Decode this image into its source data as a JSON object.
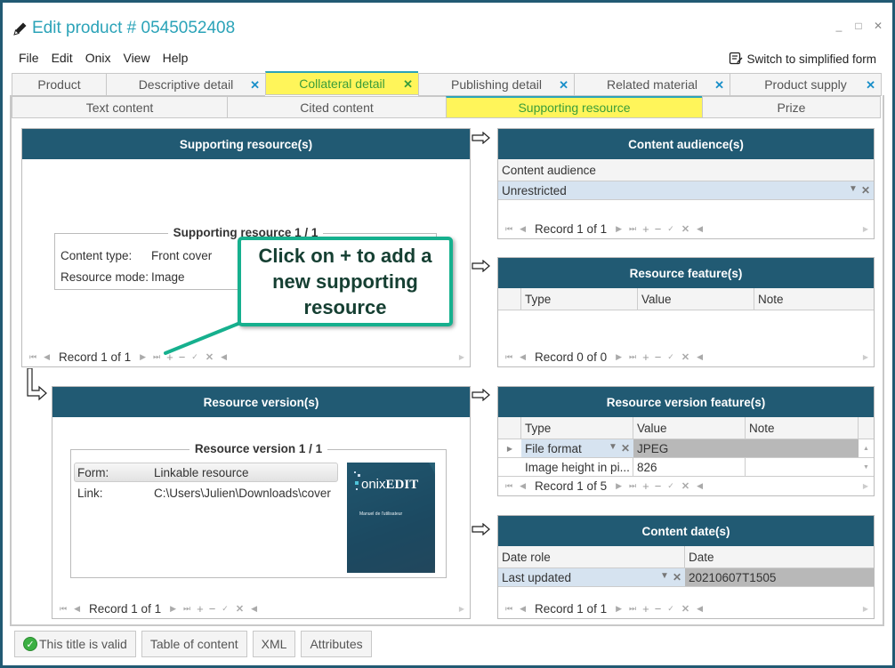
{
  "window": {
    "title": "Edit product # 0545052408",
    "controls": {
      "minimize": "_",
      "maximize": "□",
      "close": "✕"
    }
  },
  "menu": {
    "items": [
      "File",
      "Edit",
      "Onix",
      "View",
      "Help"
    ]
  },
  "switch_link": "Switch to simplified form",
  "main_tabs": [
    {
      "label": "Product",
      "closable": false,
      "active": false
    },
    {
      "label": "Descriptive detail",
      "closable": true,
      "active": false
    },
    {
      "label": "Collateral detail",
      "closable": true,
      "active": true
    },
    {
      "label": "Publishing detail",
      "closable": true,
      "active": false
    },
    {
      "label": "Related material",
      "closable": true,
      "active": false
    },
    {
      "label": "Product supply",
      "closable": true,
      "active": false
    }
  ],
  "sub_tabs": [
    {
      "label": "Text content",
      "active": false
    },
    {
      "label": "Cited content",
      "active": false
    },
    {
      "label": "Supporting resource",
      "active": true
    },
    {
      "label": "Prize",
      "active": false
    }
  ],
  "nav_icons": {
    "first": "⏮",
    "prev": "◀",
    "next": "▶",
    "last": "⏭",
    "add": "+",
    "remove": "−",
    "confirm": "✓",
    "cancel": "✕"
  },
  "supporting_resources": {
    "header": "Supporting resource(s)",
    "legend": "Supporting resource 1 / 1",
    "fields": [
      {
        "label": "Content type:",
        "value": "Front cover"
      },
      {
        "label": "Resource mode:",
        "value": "Image"
      }
    ],
    "record": "Record 1 of 1"
  },
  "content_audiences": {
    "header": "Content audience(s)",
    "column": "Content audience",
    "rows": [
      "Unrestricted"
    ],
    "record": "Record 1 of 1"
  },
  "resource_features": {
    "header": "Resource feature(s)",
    "columns": [
      "Type",
      "Value",
      "Note"
    ],
    "rows": [],
    "record": "Record 0 of 0"
  },
  "resource_versions": {
    "header": "Resource version(s)",
    "legend": "Resource version 1 / 1",
    "fields": [
      {
        "label": "Form:",
        "value": "Linkable resource"
      },
      {
        "label": "Link:",
        "value": "C:\\Users\\Julien\\Downloads\\cover"
      }
    ],
    "thumbnail": {
      "brand_light": "onix",
      "brand_bold": "EDIT",
      "subtitle": "Manuel de l'utilisateur"
    },
    "record": "Record 1 of 1"
  },
  "resource_version_features": {
    "header": "Resource version feature(s)",
    "columns": [
      "Type",
      "Value",
      "Note"
    ],
    "rows": [
      {
        "type": "File format",
        "value": "JPEG",
        "note": ""
      },
      {
        "type": "Image height in pi...",
        "value": "826",
        "note": ""
      }
    ],
    "record": "Record 1 of 5"
  },
  "content_dates": {
    "header": "Content date(s)",
    "columns": [
      "Date role",
      "Date"
    ],
    "rows": [
      {
        "role": "Last updated",
        "date": "20210607T1505"
      }
    ],
    "record": "Record 1 of 1"
  },
  "callout": "Click on + to add a new supporting resource",
  "bottom_buttons": [
    "This title is valid",
    "Table of content",
    "XML",
    "Attributes"
  ],
  "colors": {
    "accent": "#2ba3b8",
    "header": "#215a73",
    "active_tab": "#fff55a",
    "callout": "#16b08e"
  }
}
